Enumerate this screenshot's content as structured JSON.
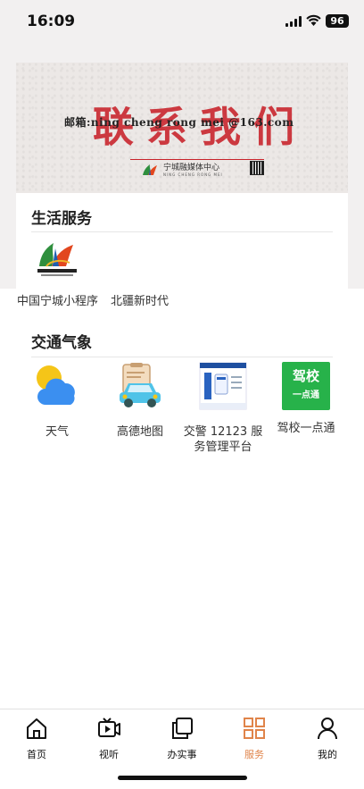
{
  "status": {
    "time": "16:09",
    "battery": "96"
  },
  "banner": {
    "email_line": "邮箱:ning cheng rong mei @163.com",
    "headline": "联系我们",
    "logo_name": "宁城融媒体中心",
    "logo_sub": "NING CHENG RONG MEI"
  },
  "life_services": {
    "title": "生活服务",
    "items": [
      {
        "label": "中国宁城小程序",
        "icon": "ningcheng-media-logo-icon"
      },
      {
        "label": "北疆新时代",
        "icon": ""
      }
    ]
  },
  "traffic_weather": {
    "title": "交通气象",
    "items": [
      {
        "label": "天气",
        "icon": "weather-icon"
      },
      {
        "label": "高德地图",
        "icon": "amap-car-icon"
      },
      {
        "label": "交警 12123 服务管理平台",
        "icon": "traffic-police-app-icon"
      },
      {
        "label": "驾校一点通",
        "icon": "driving-school-icon"
      }
    ],
    "driving_badge": {
      "line1": "驾校",
      "line2": "一点通"
    }
  },
  "tabbar": {
    "items": [
      {
        "label": "首页",
        "icon": "home-icon"
      },
      {
        "label": "视听",
        "icon": "video-icon"
      },
      {
        "label": "办实事",
        "icon": "pages-icon"
      },
      {
        "label": "服务",
        "icon": "grid-icon",
        "active": true
      },
      {
        "label": "我的",
        "icon": "user-icon"
      }
    ],
    "active_color": "#e0844a"
  }
}
